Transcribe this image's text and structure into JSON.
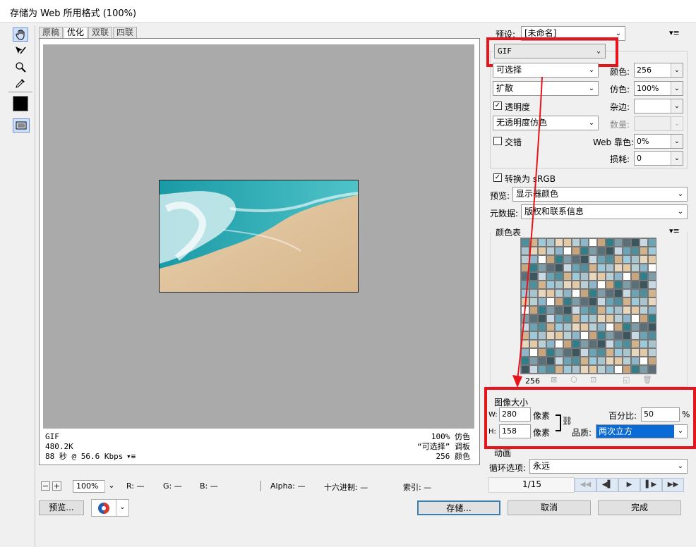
{
  "window": {
    "title": "存储为 Web 所用格式 (100%)"
  },
  "tabs": [
    "原稿",
    "优化",
    "双联",
    "四联"
  ],
  "active_tab": "优化",
  "info": {
    "left": [
      "GIF",
      "480.2K",
      "88 秒 @ 56.6 Kbps"
    ],
    "left_menu_icon": "▾≡",
    "right": [
      "100% 仿色",
      "“可选择” 调板",
      "256 颜色"
    ]
  },
  "bottom": {
    "zoom_minus": "−",
    "zoom_plus": "+",
    "zoom": "100%",
    "r": "R: —",
    "g": "G: —",
    "b": "B: —",
    "alpha": "Alpha: —",
    "hex": "十六进制: —",
    "index": "索引: —"
  },
  "buttons": {
    "preview": "预览...",
    "save": "存储...",
    "cancel": "取消",
    "done": "完成"
  },
  "settings": {
    "preset_label": "预设:",
    "preset_value": "[未命名]",
    "format": "GIF",
    "reduction": "可选择",
    "dither_algo": "扩散",
    "transparency_label": "透明度",
    "transparency_checked": true,
    "trans_dither": "无透明度仿色",
    "interlaced_label": "交错",
    "interlaced_checked": false,
    "colors_label": "颜色:",
    "colors_value": "256",
    "dither_label": "仿色:",
    "dither_value": "100%",
    "matte_label": "杂边:",
    "amount_label": "数量:",
    "websnap_label": "Web 靠色:",
    "websnap_value": "0%",
    "lossy_label": "损耗:",
    "lossy_value": "0",
    "convert_srgb_label": "转换为 sRGB",
    "convert_srgb_checked": true,
    "preview_label": "预览:",
    "preview_value": "显示器颜色",
    "metadata_label": "元数据:",
    "metadata_value": "版权和联系信息"
  },
  "color_table": {
    "title": "颜色表",
    "count": "256"
  },
  "image_size": {
    "title": "图像大小",
    "w_label": "W:",
    "w_value": "280",
    "h_label": "H:",
    "h_value": "158",
    "px_unit": "像素",
    "percent_label": "百分比:",
    "percent_value": "50",
    "percent_unit": "%",
    "quality_label": "品质:",
    "quality_value": "两次立方"
  },
  "animation": {
    "title": "动画",
    "loop_label": "循环选项:",
    "loop_value": "永远",
    "frame": "1/15"
  },
  "colors": {
    "highlight": "#e8141c",
    "accent": "#0a6bd6",
    "canvas_bg": "#aaaaaa"
  }
}
